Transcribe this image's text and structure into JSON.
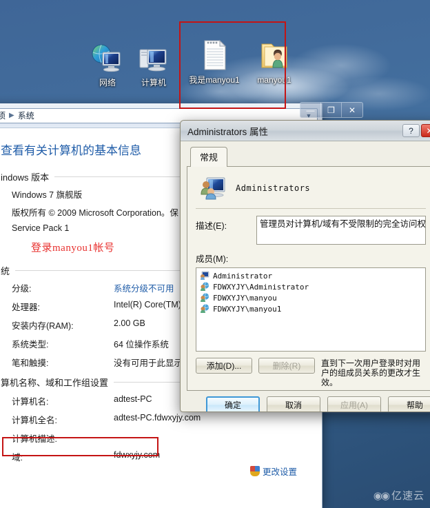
{
  "desktop": {
    "background_color": "#40699c",
    "icons": [
      {
        "name": "network",
        "label": "网络",
        "glyph": "network-icon"
      },
      {
        "name": "computer",
        "label": "计算机",
        "glyph": "computer-icon"
      },
      {
        "name": "file",
        "label": "我是manyou1",
        "glyph": "text-file-icon"
      },
      {
        "name": "folder",
        "label": "manyou1",
        "glyph": "user-folder-icon"
      }
    ]
  },
  "annotations": {
    "color": "#c41414",
    "desktop_box": "red-highlight-rectangle-desktop-icons",
    "login_note": "登录manyou1帐号",
    "pcname_box": "red-highlight-rectangle-computer-name",
    "members_underline": "red-underline-manyou1-member"
  },
  "system_window": {
    "address_bar": {
      "crumb1": "面板项",
      "separator": "▶",
      "crumb2": "系统",
      "caret": "▼"
    },
    "window_buttons": {
      "minimize": "—",
      "maximize": "❐",
      "close": "✕"
    },
    "heading": "查看有关计算机的基本信息",
    "sections": [
      {
        "title": "indows 版本",
        "lines": [
          "Windows 7 旗舰版",
          "版权所有 © 2009 Microsoft Corporation。保",
          "Service Pack 1"
        ]
      },
      {
        "title": "统",
        "rows": [
          {
            "key": "分级:",
            "value": "系统分级不可用",
            "link": true
          },
          {
            "key": "处理器:",
            "value": "Intel(R) Core(TM)",
            "link": false
          },
          {
            "key": "安装内存(RAM):",
            "value": "2.00 GB",
            "link": false
          },
          {
            "key": "系统类型:",
            "value": "64 位操作系统",
            "link": false
          },
          {
            "key": "笔和触摸:",
            "value": "没有可用于此显示器",
            "link": false
          }
        ]
      },
      {
        "title": "算机名称、域和工作组设置",
        "rows": [
          {
            "key": "计算机名:",
            "value": "adtest-PC",
            "link": false
          },
          {
            "key": "计算机全名:",
            "value": "adtest-PC.fdwxyjy.com",
            "link": false
          },
          {
            "key": "计算机描述:",
            "value": "",
            "link": false
          },
          {
            "key": "域:",
            "value": "fdwxyjy.com",
            "link": false
          }
        ]
      }
    ],
    "change_settings_link": "更改设置"
  },
  "properties_dialog": {
    "title": "Administrators 属性",
    "title_buttons": {
      "help": "?",
      "close": "✕"
    },
    "tabs": [
      {
        "label": "常规",
        "active": true
      }
    ],
    "group": {
      "icon": "group-users-icon",
      "name": "Administrators"
    },
    "description": {
      "label": "描述(E):",
      "value": "管理员对计算机/域有不受限制的完全访问权"
    },
    "members": {
      "label": "成员(M):",
      "items": [
        {
          "name": "Administrator",
          "icon": "local-user-icon"
        },
        {
          "name": "FDWXYJY\\Administrator",
          "icon": "domain-user-icon"
        },
        {
          "name": "FDWXYJY\\manyou",
          "icon": "domain-user-icon"
        },
        {
          "name": "FDWXYJY\\manyou1",
          "icon": "domain-user-icon"
        }
      ]
    },
    "member_buttons": {
      "add": "添加(D)...",
      "remove": "删除(R)"
    },
    "note": "直到下一次用户登录时对用户的组成员关系的更改才生效。",
    "footer_buttons": {
      "ok": "确定",
      "cancel": "取消",
      "apply": "应用(A)",
      "help": "帮助"
    }
  },
  "watermark": {
    "logo": "◉◉",
    "text": "亿速云"
  }
}
